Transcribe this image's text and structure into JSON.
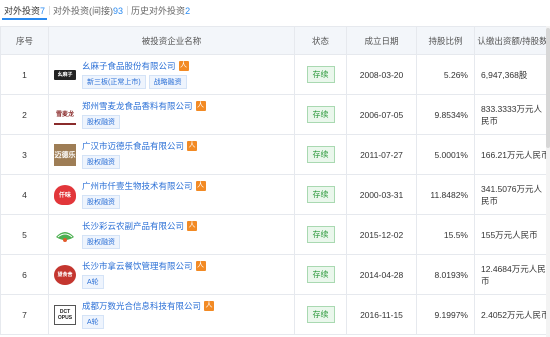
{
  "tabs": [
    {
      "label": "对外投资",
      "count": "7"
    },
    {
      "label": "对外投资(间接)",
      "count": "93"
    },
    {
      "label": "历史对外投资",
      "count": "2"
    }
  ],
  "columns": [
    "序号",
    "被投资企业名称",
    "状态",
    "成立日期",
    "持股比例",
    "认缴出资额/持股数"
  ],
  "rows": [
    {
      "no": "1",
      "logo": "幺麻子",
      "name": "幺麻子食品股份有限公司",
      "tags": [
        "新三板(正常上市)",
        "战略融资"
      ],
      "status": "存续",
      "date": "2008-03-20",
      "ratio": "5.26%",
      "amount": "6,947,368股"
    },
    {
      "no": "2",
      "logo": "雪麦龙",
      "name": "郑州雪麦龙食品香料有限公司",
      "tags": [
        "股权融资"
      ],
      "status": "存续",
      "date": "2006-07-05",
      "ratio": "9.8534%",
      "amount": "833.3333万元人民币"
    },
    {
      "no": "3",
      "logo": "迈德乐",
      "name": "广汉市迈德乐食品有限公司",
      "tags": [
        "股权融资"
      ],
      "status": "存续",
      "date": "2011-07-27",
      "ratio": "5.0001%",
      "amount": "166.21万元人民币"
    },
    {
      "no": "4",
      "logo": "仟味",
      "name": "广州市仟壹生物技术有限公司",
      "tags": [
        "股权融资"
      ],
      "status": "存续",
      "date": "2000-03-31",
      "ratio": "11.8482%",
      "amount": "341.5076万元人民币"
    },
    {
      "no": "5",
      "logo": "",
      "name": "长沙彩云农副产品有限公司",
      "tags": [
        "股权融资"
      ],
      "status": "存续",
      "date": "2015-12-02",
      "ratio": "15.5%",
      "amount": "155万元人民币"
    },
    {
      "no": "6",
      "logo": "望食舍",
      "name": "长沙市拿云餐饮管理有限公司",
      "tags": [
        "A轮"
      ],
      "status": "存续",
      "date": "2014-04-28",
      "ratio": "8.0193%",
      "amount": "12.4684万元人民币"
    },
    {
      "no": "7",
      "logo": "DCT OPUS",
      "name": "成都万数光合信息科技有限公司",
      "tags": [
        "A轮"
      ],
      "status": "存续",
      "date": "2016-11-15",
      "ratio": "9.1997%",
      "amount": "2.4052万元人民币"
    }
  ]
}
